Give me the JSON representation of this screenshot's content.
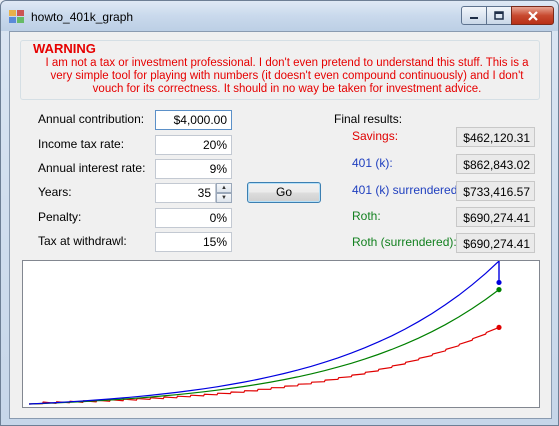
{
  "window": {
    "title": "howto_401k_graph"
  },
  "warning": {
    "heading": "WARNING",
    "text": "I am not a tax or investment professional. I don't even pretend to understand this stuff. This is a very simple tool for playing with numbers (it doesn't even compound continuously) and I don't vouch for its correctness. It should in no way be taken for investment advice."
  },
  "inputs": {
    "annual_contribution": {
      "label": "Annual contribution:",
      "value": "$4,000.00"
    },
    "income_tax_rate": {
      "label": "Income tax rate:",
      "value": "20%"
    },
    "annual_interest_rate": {
      "label": "Annual interest rate:",
      "value": "9%"
    },
    "years": {
      "label": "Years:",
      "value": "35"
    },
    "penalty": {
      "label": "Penalty:",
      "value": "0%"
    },
    "tax_at_withdrawl": {
      "label": "Tax at withdrawl:",
      "value": "15%"
    }
  },
  "go_label": "Go",
  "results": {
    "heading": "Final results:",
    "rows": [
      {
        "label": "Savings:",
        "value": "$462,120.31",
        "color": "#e00000"
      },
      {
        "label": "401 (k):",
        "value": "$862,843.02",
        "color": "#1f3fbf"
      },
      {
        "label": "401 (k) surrendered:",
        "value": "$733,416.57",
        "color": "#1f3fbf"
      },
      {
        "label": "Roth:",
        "value": "$690,274.41",
        "color": "#12801f"
      },
      {
        "label": "Roth (surrendered):",
        "value": "$690,274.41",
        "color": "#12801f"
      }
    ]
  },
  "graph": {
    "years": 35,
    "final_values": {
      "savings": 462120.31,
      "k401": 862843.02,
      "k401_surrendered": 733416.57,
      "roth": 690274.41
    },
    "colors": {
      "savings": "#e00000",
      "k401": "#0000e0",
      "roth": "#008000"
    }
  }
}
